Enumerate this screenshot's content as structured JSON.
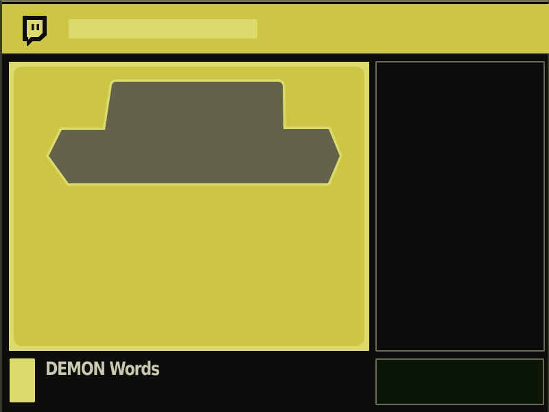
{
  "colors": {
    "accent": "#cdc645",
    "accent_light": "#dcda6c",
    "video_shape": "#636349",
    "background": "#0d0d0b",
    "border": "#6b6b55",
    "chat_input_bg": "#0b1607"
  },
  "header": {
    "logo_icon": "chat-bubble-icon",
    "search": {
      "value": ""
    }
  },
  "channel": {
    "name": "DEMON Words"
  }
}
